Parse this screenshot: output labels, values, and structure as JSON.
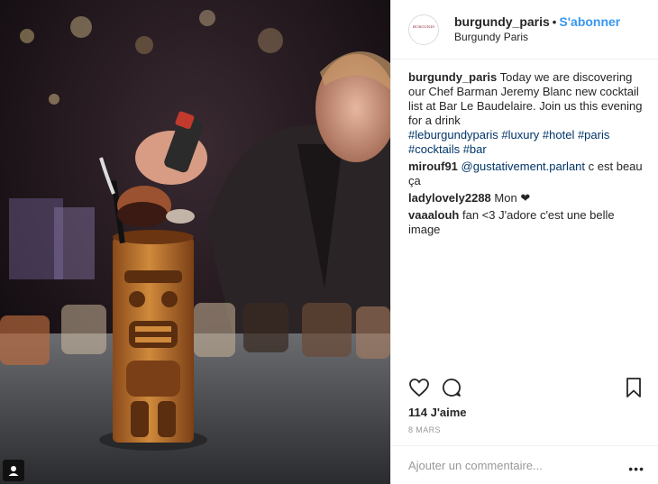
{
  "header": {
    "username": "burgundy_paris",
    "separator": "•",
    "follow_label": "S'abonner",
    "location": "Burgundy Paris",
    "avatar_text": "BURGUNDY"
  },
  "caption": {
    "username": "burgundy_paris",
    "text": "Today we are discovering our Chef Barman Jeremy Blanc new cocktail list at Bar Le Baudelaire. Join us this evening for a drink",
    "hashtags": [
      "#leburgundyparis",
      "#luxury",
      "#hotel",
      "#paris",
      "#cocktails",
      "#bar"
    ]
  },
  "comments": [
    {
      "username": "mirouf91",
      "mention": "@gustativement.parlant",
      "text": "c est beau ça"
    },
    {
      "username": "ladylovely2288",
      "text": "Mon ❤"
    },
    {
      "username": "vaaalouh",
      "text": "fan <3 J'adore c'est une belle image"
    }
  ],
  "actions": {
    "like_icon": "heart-icon",
    "comment_icon": "comment-icon",
    "save_icon": "bookmark-icon"
  },
  "likes_label": "114 J'aime",
  "date_label": "8 MARS",
  "add_comment": {
    "placeholder": "Ajouter un commentaire...",
    "more_label": "•••"
  },
  "colors": {
    "link": "#003569",
    "follow": "#3897f0",
    "muted": "#999999"
  }
}
